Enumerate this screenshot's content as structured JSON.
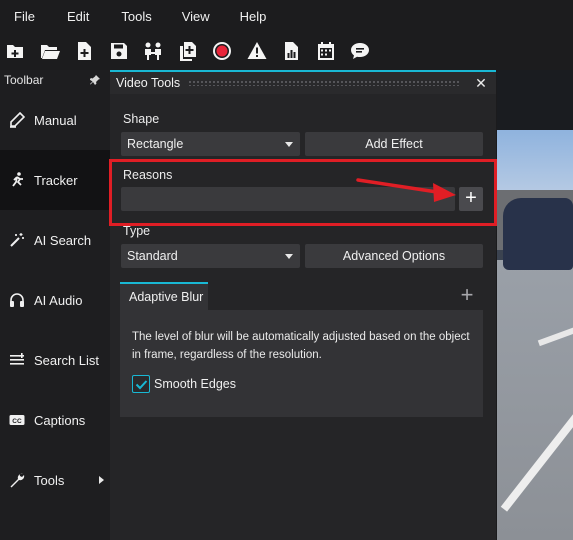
{
  "menu": [
    "File",
    "Edit",
    "Tools",
    "View",
    "Help"
  ],
  "toolbar_icons": [
    "new-project-icon",
    "open-folder-icon",
    "new-file-icon",
    "save-icon",
    "people-icon",
    "add-copy-icon",
    "record-icon",
    "warning-icon",
    "report-icon",
    "calendar-icon",
    "chat-icon"
  ],
  "sidebar": {
    "title": "Toolbar",
    "items": [
      {
        "label": "Manual",
        "icon": "pencil-icon"
      },
      {
        "label": "Tracker",
        "icon": "running-person-icon"
      },
      {
        "label": "AI Search",
        "icon": "magic-wand-icon"
      },
      {
        "label": "AI Audio",
        "icon": "headphones-icon"
      },
      {
        "label": "Search List",
        "icon": "list-icon"
      },
      {
        "label": "Captions",
        "icon": "closed-captions-icon"
      },
      {
        "label": "Tools",
        "icon": "wrench-icon"
      }
    ]
  },
  "panel": {
    "title": "Video Tools",
    "shape_label": "Shape",
    "shape_value": "Rectangle",
    "add_effect": "Add Effect",
    "reasons_label": "Reasons",
    "reasons_value": "",
    "type_label": "Type",
    "type_value": "Standard",
    "advanced_options": "Advanced Options",
    "tab_label": "Adaptive Blur",
    "tab_plus": "+",
    "description": "The level of blur will be automatically adjusted based on the object in frame, regardless of the resolution.",
    "smooth_edges_label": "Smooth Edges",
    "smooth_edges_checked": true
  },
  "colors": {
    "accent": "#19b8d4",
    "highlight": "#e01e25"
  }
}
